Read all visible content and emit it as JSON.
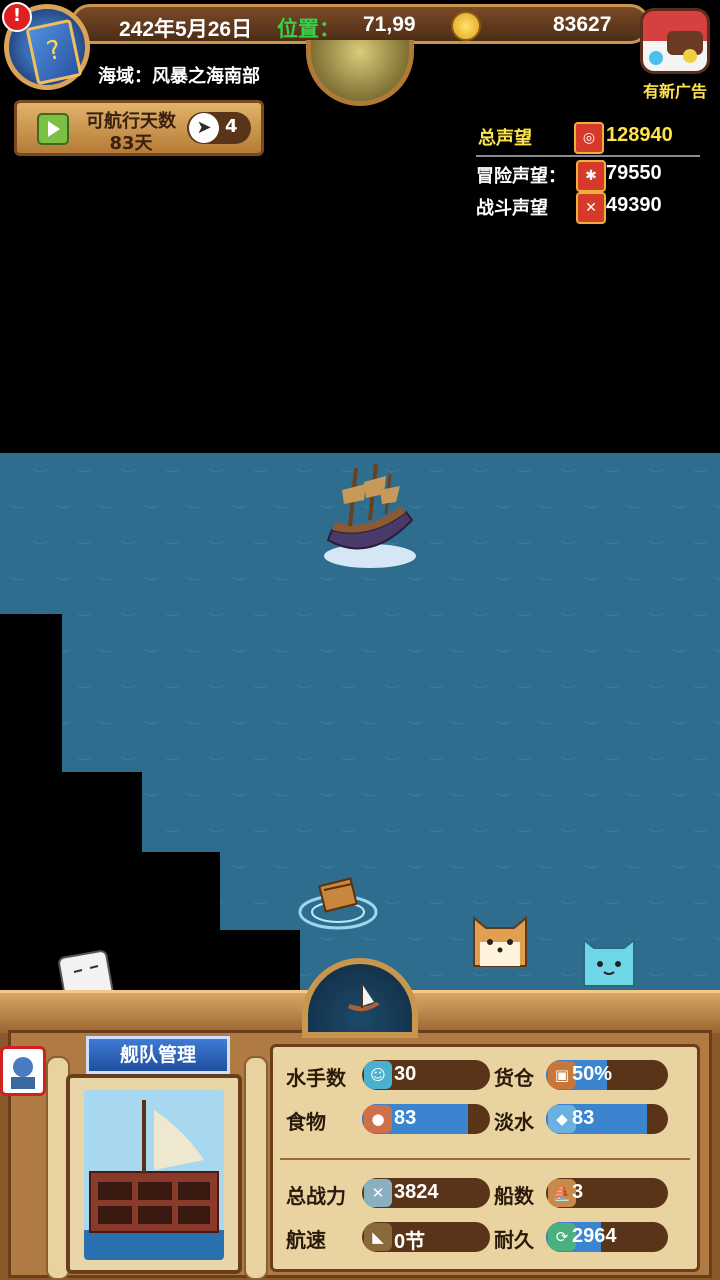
{
  "topbar": {
    "date": "242年5月26日",
    "position_label": "位置：",
    "position_value": "71,99",
    "gold": "83627",
    "ad_label": "有新广告",
    "alert_mark": "!"
  },
  "region": {
    "label": "海域：风暴之海南部"
  },
  "voyage": {
    "title": "可航行天数",
    "days": "83天",
    "nav_count": "4"
  },
  "reputation": {
    "total_label": "总声望",
    "total_value": "128940",
    "adventure_label": "冒险声望：",
    "adventure_value": "79550",
    "battle_label": "战斗声望",
    "battle_value": "49390"
  },
  "fleet": {
    "title": "舰队管理",
    "stats": {
      "sailors_label": "水手数",
      "sailors_value": "30",
      "cargo_label": "货仓",
      "cargo_value": "50%",
      "cargo_fill": 0.5,
      "food_label": "食物",
      "food_value": "83",
      "food_fill": 0.83,
      "water_label": "淡水",
      "water_value": "83",
      "water_fill": 0.83,
      "power_label": "总战力",
      "power_value": "3824",
      "ships_label": "船数",
      "ships_value": "3",
      "speed_label": "航速",
      "speed_value": "0节",
      "durability_label": "耐久",
      "durability_value": "2964",
      "durability_fill": 0.45
    }
  },
  "colors": {
    "sea": "#2f6d8f",
    "gold_text": "#ffe34a",
    "position_label": "#36d14a",
    "bar_fill": "#3a84d0"
  },
  "icons": {
    "book": "book-icon",
    "coin": "coin-icon",
    "chest": "treasure-chest-icon",
    "play": "play-icon",
    "compass": "compass-arrow-icon"
  }
}
